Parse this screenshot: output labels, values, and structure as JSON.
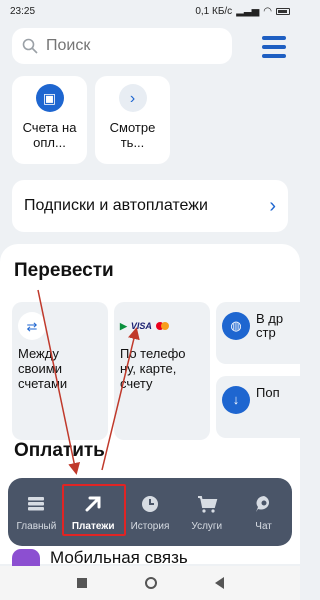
{
  "status_bar": {
    "time": "23:25",
    "network": "0,1 КБ/с",
    "signal": "▂▃▅"
  },
  "search": {
    "placeholder": "Поиск"
  },
  "shortcuts": [
    {
      "label": "Счета на опл..."
    },
    {
      "label": "Смотре ть..."
    }
  ],
  "subscriptions": {
    "label": "Подписки и автоплатежи"
  },
  "transfer": {
    "title": "Перевести",
    "cards": [
      {
        "label": "Между своими счетами"
      },
      {
        "label": "По телефо ну, карте, счету",
        "logo_visa": "VISA"
      },
      {
        "label": "В др стр"
      },
      {
        "label": "Поп"
      }
    ]
  },
  "pay": {
    "title": "Оплатить"
  },
  "bottom_nav": {
    "items": [
      {
        "label": "Главный",
        "icon": "cards-icon"
      },
      {
        "label": "Платежи",
        "icon": "arrow-up-right-icon",
        "active": true
      },
      {
        "label": "История",
        "icon": "clock-icon"
      },
      {
        "label": "Услуги",
        "icon": "cart-icon"
      },
      {
        "label": "Чат",
        "icon": "chat-icon"
      }
    ]
  },
  "peek": {
    "label": "Мобильная связь"
  },
  "colors": {
    "accent": "#1e66d0",
    "nav_bg": "#4a5568",
    "annotation": "#e02424"
  }
}
